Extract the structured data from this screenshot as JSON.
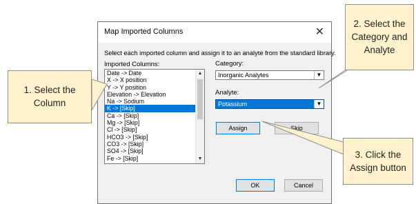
{
  "dialog": {
    "title": "Map Imported Columns",
    "close_glyph": "✕",
    "instruction": "Select each imported column and assign it to an analyte from the standard library.",
    "imported_columns_label": "Imported Columns:",
    "imported_columns": [
      "Date  ->  Date",
      "X  ->  X position",
      "Y  ->  Y position",
      "Elevation  ->  Elevation",
      "Na  ->  Sodium",
      "K  ->  [Skip]",
      "Ca  ->  [Skip]",
      "Mg  ->  [Skip]",
      "Cl  ->  [Skip]",
      "HCO3  ->  [Skip]",
      "CO3  ->  [Skip]",
      "SO4  ->  [Skip]",
      "Fe  ->  [Skip]"
    ],
    "selected_index": 5,
    "scroll_up_glyph": "▲",
    "scroll_down_glyph": "▼",
    "category_label": "Category:",
    "category_value": "Inorganic Analytes",
    "analyte_label": "Analyte:",
    "analyte_value": "Potassium",
    "dropdown_glyph": "▼",
    "assign_label": "Assign",
    "skip_label": "Skip",
    "ok_label": "OK",
    "cancel_label": "Cancel"
  },
  "callouts": {
    "select_column": [
      "1. Select the",
      "Column"
    ],
    "select_category": [
      "2. Select the",
      "Category and",
      "Analyte"
    ],
    "click_assign": [
      "3. Click the",
      "Assign button"
    ]
  },
  "colors": {
    "callout_fill": "#fff2cc",
    "selection": "#0078d7"
  }
}
